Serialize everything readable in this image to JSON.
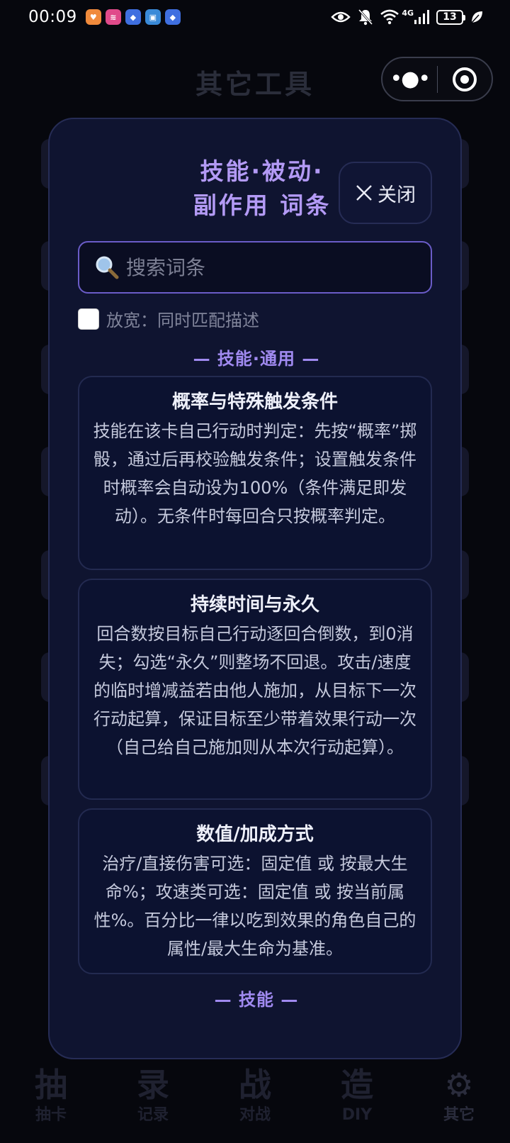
{
  "status_bar": {
    "time": "00:09",
    "network": "4G",
    "battery": "13"
  },
  "header": {
    "title": "其它工具"
  },
  "modal": {
    "title_line1": "技能·被动·",
    "title_line2": "副作用 词条",
    "close_label": "关闭",
    "search_placeholder": "搜索词条",
    "checkbox_label": "放宽：同时匹配描述",
    "section_general": "— 技能·通用 —",
    "section_skills": "— 技能 —",
    "cards": [
      {
        "title": "概率与特殊触发条件",
        "text": "技能在该卡自己行动时判定：先按“概率”掷骰，通过后再校验触发条件；设置触发条件时概率会自动设为100%（条件满足即发动）。无条件时每回合只按概率判定。"
      },
      {
        "title": "持续时间与永久",
        "text": "回合数按目标自己行动逐回合倒数，到0消失；勾选“永久”则整场不回退。攻击/速度的临时增减益若由他人施加，从目标下一次行动起算，保证目标至少带着效果行动一次（自己给自己施加则从本次行动起算）。"
      },
      {
        "title": "数值/加成方式",
        "text": "治疗/直接伤害可选：固定值 或 按最大生命%；攻速类可选：固定值 或 按当前属性%。百分比一律以吃到效果的角色自己的属性/最大生命为基准。"
      }
    ]
  },
  "bottom_nav": {
    "items": [
      {
        "glyph": "抽",
        "label": "抽卡"
      },
      {
        "glyph": "录",
        "label": "记录"
      },
      {
        "glyph": "战",
        "label": "对战"
      },
      {
        "glyph": "造",
        "label": "DIY"
      },
      {
        "glyph": "⚙",
        "label": "其它"
      }
    ]
  }
}
